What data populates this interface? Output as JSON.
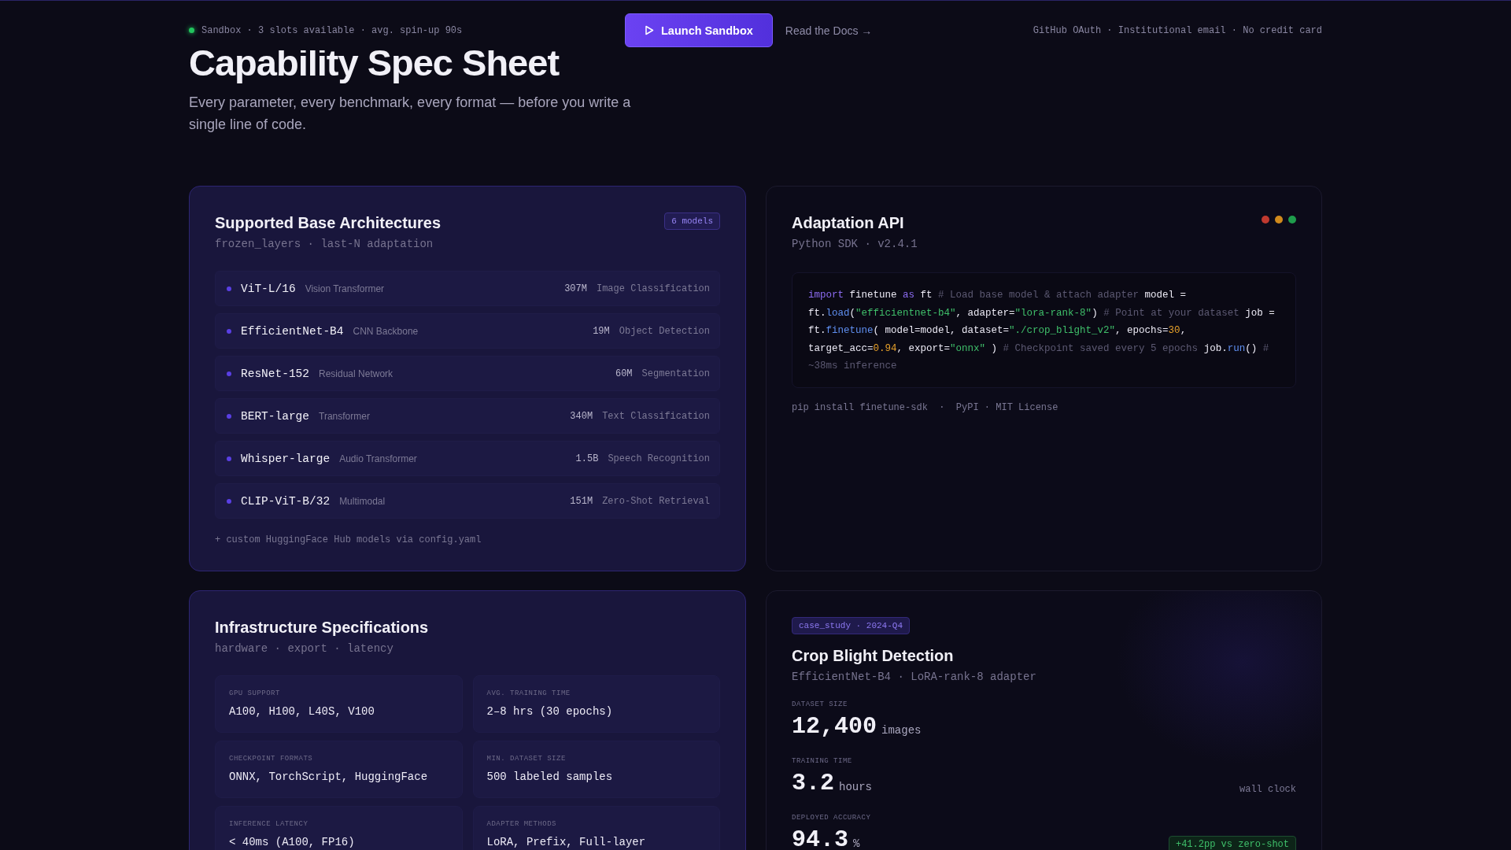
{
  "topbar": {
    "status": "Sandbox · 3 slots available · avg. spin-up 90s",
    "launch": "Launch Sandbox",
    "docs": "Read the Docs →",
    "auth": "GitHub OAuth · Institutional email · No credit card"
  },
  "hero": {
    "title": "Capability Spec Sheet",
    "subtitle": "Every parameter, every benchmark, every format — before you write a single line of code."
  },
  "architectures": {
    "title": "Supported Base Architectures",
    "subtitle": "frozen_layers · last-N adaptation",
    "badge": "6 models",
    "models": [
      {
        "name": "ViT-L/16",
        "family": "Vision Transformer",
        "params": "307M",
        "task": "Image Classification"
      },
      {
        "name": "EfficientNet-B4",
        "family": "CNN Backbone",
        "params": "19M",
        "task": "Object Detection"
      },
      {
        "name": "ResNet-152",
        "family": "Residual Network",
        "params": "60M",
        "task": "Segmentation"
      },
      {
        "name": "BERT-large",
        "family": "Transformer",
        "params": "340M",
        "task": "Text Classification"
      },
      {
        "name": "Whisper-large",
        "family": "Audio Transformer",
        "params": "1.5B",
        "task": "Speech Recognition"
      },
      {
        "name": "CLIP-ViT-B/32",
        "family": "Multimodal",
        "params": "151M",
        "task": "Zero-Shot Retrieval"
      }
    ],
    "footer": "+ custom HuggingFace Hub models via config.yaml"
  },
  "api": {
    "title": "Adaptation API",
    "subtitle": "Python SDK · v2.4.1",
    "window_dots": [
      {
        "color": "#c0392f"
      },
      {
        "color": "#d08a1c"
      },
      {
        "color": "#1f9d4c"
      }
    ],
    "code": [
      {
        "kind": "keyword",
        "text": "import"
      },
      {
        "kind": "plain",
        "text": " finetune "
      },
      {
        "kind": "keyword",
        "text": "as"
      },
      {
        "kind": "plain",
        "text": " ft "
      },
      {
        "kind": "comment",
        "text": "# Load base model & attach adapter"
      },
      {
        "kind": "plain",
        "text": " model = ft."
      },
      {
        "kind": "func",
        "text": "load"
      },
      {
        "kind": "plain",
        "text": "("
      },
      {
        "kind": "string",
        "text": "\"efficientnet-b4\""
      },
      {
        "kind": "plain",
        "text": ", adapter="
      },
      {
        "kind": "string",
        "text": "\"lora-rank-8\""
      },
      {
        "kind": "plain",
        "text": ") "
      },
      {
        "kind": "comment",
        "text": "# Point at your dataset"
      },
      {
        "kind": "plain",
        "text": " job = ft."
      },
      {
        "kind": "func",
        "text": "finetune"
      },
      {
        "kind": "plain",
        "text": "( model=model, dataset="
      },
      {
        "kind": "string",
        "text": "\"./crop_blight_v2\""
      },
      {
        "kind": "plain",
        "text": ", epochs="
      },
      {
        "kind": "number",
        "text": "30"
      },
      {
        "kind": "plain",
        "text": ", target_acc="
      },
      {
        "kind": "number",
        "text": "0.94"
      },
      {
        "kind": "plain",
        "text": ", export="
      },
      {
        "kind": "string",
        "text": "\"onnx\""
      },
      {
        "kind": "plain",
        "text": " ) "
      },
      {
        "kind": "comment",
        "text": "# Checkpoint saved every 5 epochs"
      },
      {
        "kind": "plain",
        "text": " job."
      },
      {
        "kind": "func",
        "text": "run"
      },
      {
        "kind": "plain",
        "text": "() "
      },
      {
        "kind": "comment",
        "text": "# ~38ms inference"
      }
    ],
    "footer": "pip install finetune-sdk  ·  PyPI · MIT License"
  },
  "infrastructure": {
    "title": "Infrastructure Specifications",
    "subtitle": "hardware · export · latency",
    "specs": [
      {
        "label": "GPU SUPPORT",
        "value": "A100, H100, L40S, V100"
      },
      {
        "label": "AVG. TRAINING TIME",
        "value": "2–8 hrs (30 epochs)"
      },
      {
        "label": "CHECKPOINT FORMATS",
        "value": "ONNX, TorchScript, HuggingFace"
      },
      {
        "label": "MIN. DATASET SIZE",
        "value": "500 labeled samples"
      },
      {
        "label": "INFERENCE LATENCY",
        "value": "< 40ms (A100, FP16)"
      },
      {
        "label": "ADAPTER METHODS",
        "value": "LoRA, Prefix, Full-layer"
      }
    ]
  },
  "case_study": {
    "tag": "case_study · 2024-Q4",
    "title": "Crop Blight Detection",
    "subtitle": "EfficientNet-B4 · LoRA-rank-8 adapter",
    "metrics": [
      {
        "label": "DATASET SIZE",
        "value": "12,400",
        "unit": "images"
      },
      {
        "label": "TRAINING TIME",
        "value": "3.2",
        "unit": "hours",
        "note": "wall clock"
      },
      {
        "label": "DEPLOYED ACCURACY",
        "value": "94.3",
        "unit": "%",
        "delta": "+41.2pp vs zero-shot"
      }
    ]
  }
}
